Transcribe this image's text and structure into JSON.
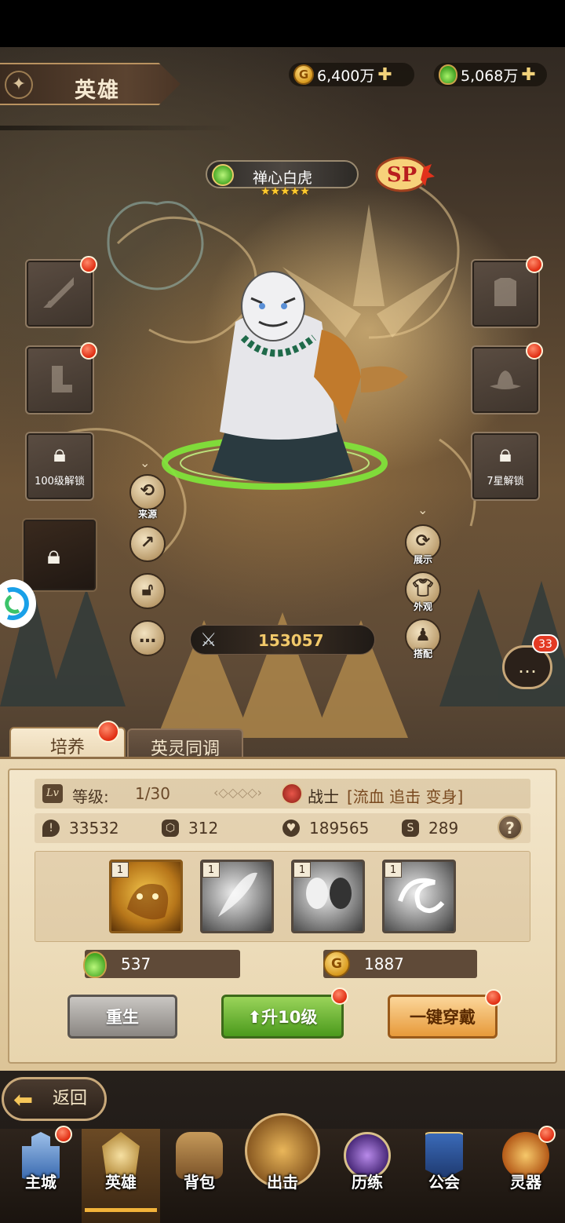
{
  "page": {
    "title": "英雄"
  },
  "currency": {
    "gold": {
      "icon": "gold-coin-icon",
      "coin_glyph": "G",
      "value": "6,400万"
    },
    "potion": {
      "icon": "green-potion-icon",
      "value": "5,068万"
    }
  },
  "hero": {
    "name": "禅心白虎",
    "stars": "★★★★★",
    "rarity": "SP",
    "power": "153057",
    "class_label": "战士",
    "tags": "[流血 追击 变身]",
    "level_label": "等级:",
    "level_value": "1/30",
    "lv_badge": "Lv",
    "stats": [
      {
        "icon": "attack-stat-icon",
        "value": "33532"
      },
      {
        "icon": "defense-stat-icon",
        "value": "312"
      },
      {
        "icon": "hp-stat-icon",
        "value": "189565"
      },
      {
        "icon": "speed-stat-icon",
        "value": "289"
      }
    ],
    "skills": [
      {
        "name": "tiger-skill",
        "level": "1",
        "style": "gold"
      },
      {
        "name": "feather-skill",
        "level": "1",
        "style": "gray"
      },
      {
        "name": "duo-skill",
        "level": "1",
        "style": "gray"
      },
      {
        "name": "swirl-skill",
        "level": "1",
        "style": "gray"
      }
    ]
  },
  "equipment": {
    "lock_left_label": "100级解锁",
    "lock_right_label": "7星解锁"
  },
  "side_actions": {
    "source_label": "来源",
    "display_label": "展示",
    "outfit_label": "外观",
    "match_label": "搭配"
  },
  "chat": {
    "count": "33"
  },
  "tabs": {
    "active": "培养",
    "inactive": "英灵同调"
  },
  "resources": {
    "potion_cost": "537",
    "gold_cost": "1887",
    "gold_glyph": "G"
  },
  "buttons": {
    "rebirth": "重生",
    "level_up": "⬆升10级",
    "equip_all": "一键穿戴"
  },
  "back": {
    "label": "返回"
  },
  "nav": [
    {
      "label": "主城",
      "icon": "castle-icon",
      "dot": true
    },
    {
      "label": "英雄",
      "icon": "hero-helmet-icon",
      "active": true
    },
    {
      "label": "背包",
      "icon": "backpack-icon"
    },
    {
      "label": "出击",
      "icon": "crossed-swords-icon"
    },
    {
      "label": "历练",
      "icon": "training-icon"
    },
    {
      "label": "公会",
      "icon": "guild-banner-icon"
    },
    {
      "label": "灵器",
      "icon": "spirit-artifact-icon",
      "dot": true
    }
  ],
  "colors": {
    "accent_gold": "#f2c96a",
    "badge_red": "#e02d12",
    "panel_bg": "#e9d7b3"
  }
}
